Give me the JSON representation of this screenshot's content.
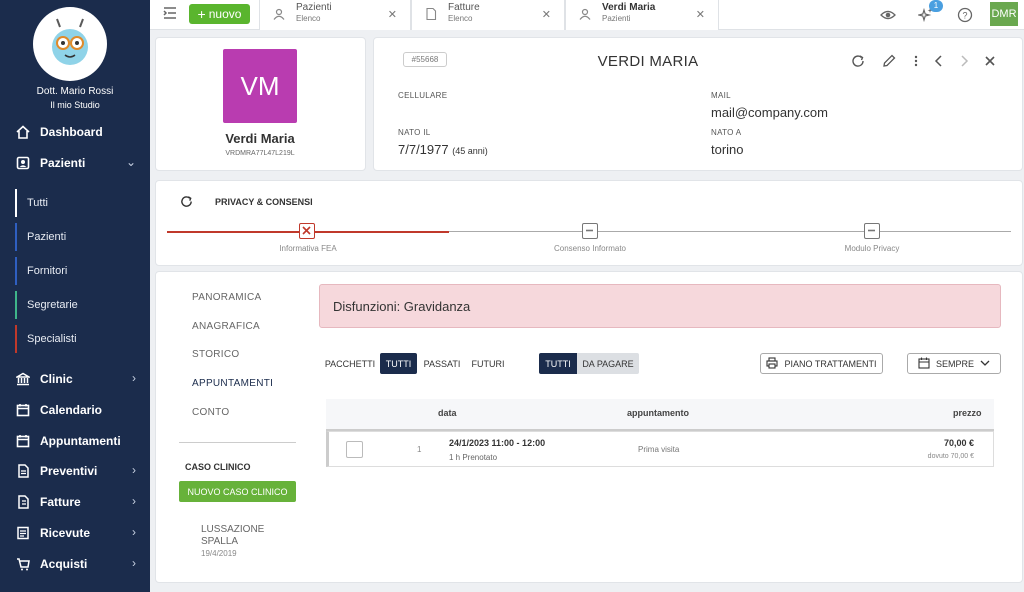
{
  "sidebar": {
    "doctor_name": "Dott. Mario Rossi",
    "studio": "Il mio Studio",
    "nav": [
      {
        "label": "Dashboard",
        "icon": "home-icon"
      },
      {
        "label": "Pazienti",
        "icon": "user-card-icon",
        "chevron": "down"
      },
      {
        "label": "Clinic",
        "icon": "bank-icon",
        "chevron": "right"
      },
      {
        "label": "Calendario",
        "icon": "calendar-icon"
      },
      {
        "label": "Appuntamenti",
        "icon": "calendar-icon"
      },
      {
        "label": "Preventivi",
        "icon": "document-icon",
        "chevron": "right"
      },
      {
        "label": "Fatture",
        "icon": "invoice-icon",
        "chevron": "right"
      },
      {
        "label": "Ricevute",
        "icon": "receipt-icon",
        "chevron": "right"
      },
      {
        "label": "Acquisti",
        "icon": "cart-icon",
        "chevron": "right"
      }
    ],
    "sub": [
      {
        "label": "Tutti",
        "color": "#ffffff"
      },
      {
        "label": "Pazienti",
        "color": "#2f5fc1"
      },
      {
        "label": "Fornitori",
        "color": "#2f5fc1"
      },
      {
        "label": "Segretarie",
        "color": "#3fb58a"
      },
      {
        "label": "Specialisti",
        "color": "#c0392b"
      }
    ]
  },
  "topbar": {
    "new_label": "nuovo",
    "tabs": [
      {
        "title": "Pazienti",
        "subtitle": "Elenco"
      },
      {
        "title": "Fatture",
        "subtitle": "Elenco"
      },
      {
        "title": "Verdi Maria",
        "subtitle": "Pazienti"
      }
    ],
    "badge": "1",
    "user_initials": "DMR"
  },
  "patient": {
    "initials": "VM",
    "name": "Verdi Maria",
    "code": "VRDMRA77L47L219L",
    "id": "#55668",
    "title": "VERDI MARIA",
    "fields": {
      "cellulare_label": "CELLULARE",
      "cellulare": "",
      "mail_label": "MAIL",
      "mail": "mail@company.com",
      "nato_il_label": "NATO IL",
      "nato_il": "7/7/1977",
      "age": "(45 anni)",
      "nato_a_label": "NATO A",
      "nato_a": "torino"
    }
  },
  "privacy": {
    "title": "PRIVACY & CONSENSI",
    "steps": [
      "Informativa FEA",
      "Consenso Informato",
      "Modulo Privacy"
    ]
  },
  "sections": [
    "PANORAMICA",
    "ANAGRAFICA",
    "STORICO",
    "APPUNTAMENTI",
    "CONTO"
  ],
  "alert": "Disfunzioni: Gravidanza",
  "filters": {
    "group1": [
      "PACCHETTI",
      "TUTTI",
      "PASSATI",
      "FUTURI"
    ],
    "group2": [
      "TUTTI",
      "DA PAGARE"
    ],
    "piano": "PIANO TRATTAMENTI",
    "sempre": "SEMPRE"
  },
  "table": {
    "headers": [
      "data",
      "appuntamento",
      "prezzo"
    ],
    "rows": [
      {
        "num": "1",
        "date": "24/1/2023 11:00 - 12:00",
        "status": "1 h Prenotato",
        "type": "Prima visita",
        "price": "70,00 €",
        "due": "dovuto 70,00 €"
      }
    ]
  },
  "caso_clinico": {
    "title": "CASO CLINICO",
    "button": "NUOVO CASO CLINICO",
    "items": [
      {
        "line1": "LUSSAZIONE",
        "line2": "SPALLA",
        "date": "19/4/2019"
      }
    ]
  },
  "colors": {
    "sidebar": "#1b2c4c",
    "accent_green": "#5ab52e",
    "avatar": "#b93cb0",
    "alert_bg": "#f6d8dc",
    "navy": "#1b2c4c"
  }
}
